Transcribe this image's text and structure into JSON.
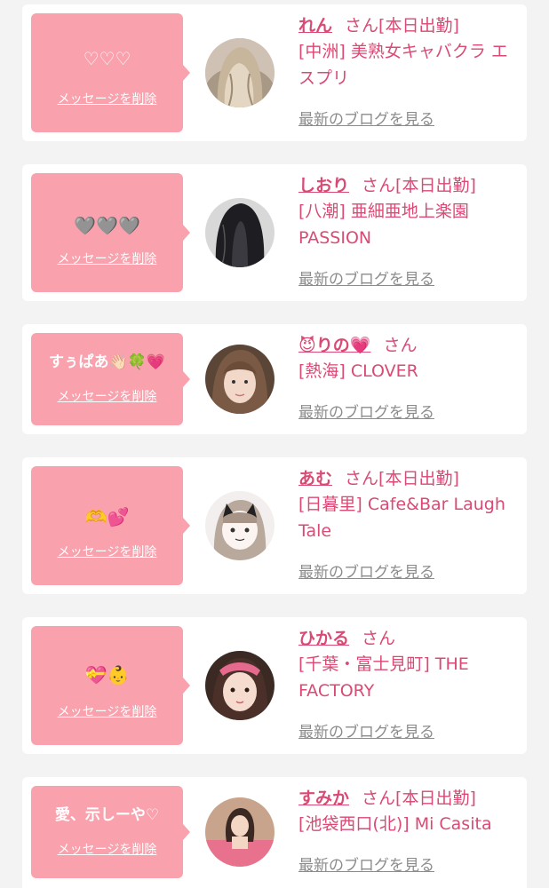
{
  "colors": {
    "accent": "#d94a74",
    "bubble": "#f9a1ad",
    "link_gray": "#8c8c8c"
  },
  "delete_label": "メッセージを削除",
  "blog_label": "最新のブログを見る",
  "san": "さん",
  "cards": [
    {
      "message": "♡♡♡",
      "name": "れん",
      "status": "[本日出勤]",
      "shop": "[中洲] 美熟女キャバクラ エスプリ",
      "avatar": "long-wavy-blonde-hair"
    },
    {
      "message": "🩶🩶🩶",
      "name": "しおり",
      "status": "[本日出勤]",
      "shop": "[八潮] 亜細亜地上楽園 PASSION",
      "avatar": "long-black-hair"
    },
    {
      "message": "すぅぱあ👋🏻🍀💗",
      "name": "😈りの💗",
      "status": "",
      "shop": "[熱海] CLOVER",
      "avatar": "brown-hair-selfie"
    },
    {
      "message": "🫶💕",
      "name": "あむ",
      "status": "[本日出勤]",
      "shop": "[日暮里] Cafe&Bar Laugh Tale",
      "avatar": "cat-filter-selfie"
    },
    {
      "message": "💝👶",
      "name": "ひかる",
      "status": "",
      "shop": "[千葉・富士見町] THE FACTORY",
      "avatar": "pink-headband-selfie"
    },
    {
      "message": "愛、示しーや♡",
      "name": "すみか",
      "status": "[本日出勤]",
      "shop": "[池袋西口(北)] Mi Casita",
      "avatar": "pink-shirt-photo"
    }
  ]
}
